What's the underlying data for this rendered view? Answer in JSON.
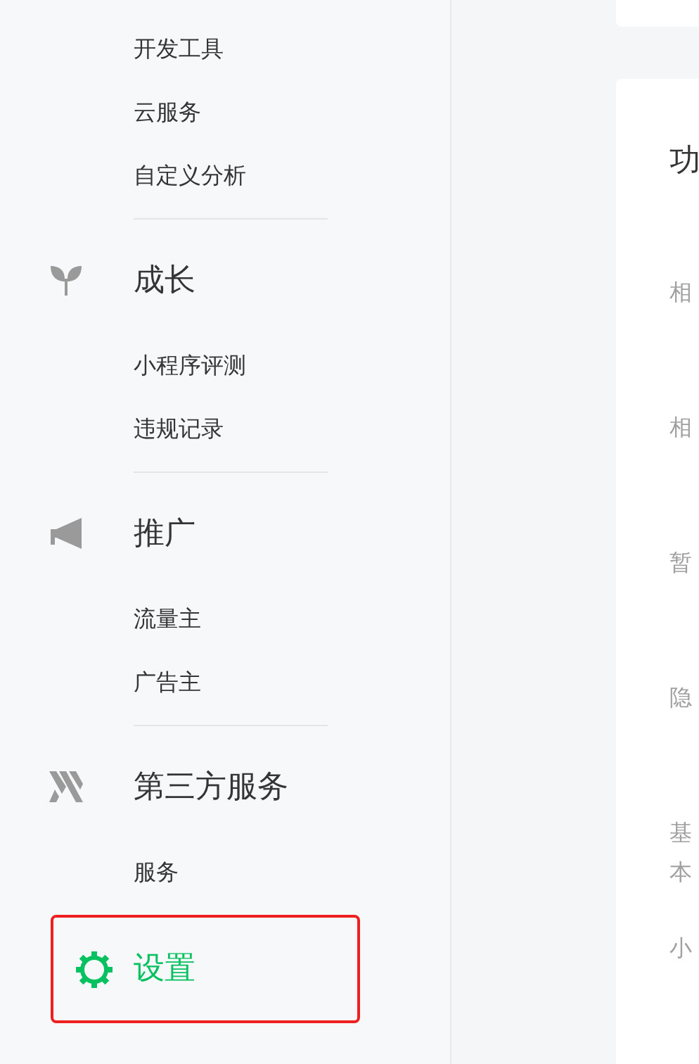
{
  "sidebar": {
    "groups": [
      {
        "items": [
          "开发工具",
          "云服务",
          "自定义分析"
        ]
      },
      {
        "title": "成长",
        "items": [
          "小程序评测",
          "违规记录"
        ]
      },
      {
        "title": "推广",
        "items": [
          "流量主",
          "广告主"
        ]
      },
      {
        "title": "第三方服务",
        "items": [
          "服务"
        ]
      }
    ],
    "settings": {
      "title": "设置",
      "selected": true,
      "annotated": true
    }
  },
  "main": {
    "card_title": "功",
    "rows": [
      [
        "相"
      ],
      [
        "相"
      ],
      [
        "暂"
      ],
      [
        "隐"
      ],
      [
        "基",
        "本"
      ],
      [
        "小"
      ]
    ]
  }
}
